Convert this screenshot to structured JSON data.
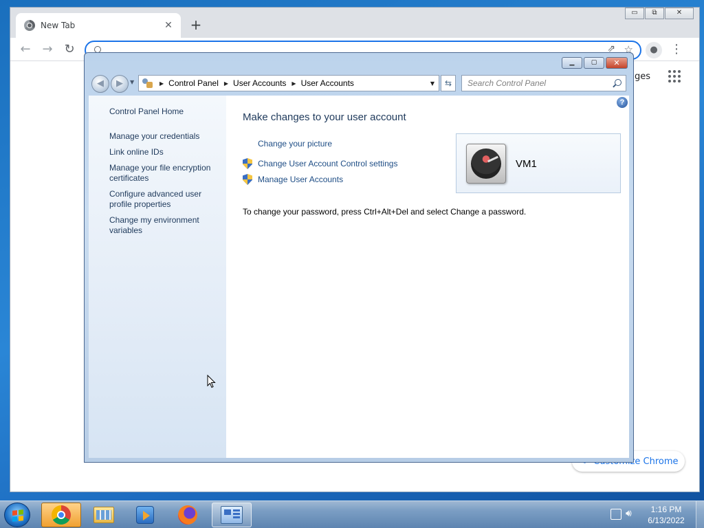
{
  "chrome": {
    "tab_title": "New Tab",
    "tab_close": "✕",
    "new_tab": "+",
    "window_controls": {
      "minimize": "▭",
      "maximize": "⧉",
      "close": "✕"
    },
    "nav": {
      "back": "←",
      "forward": "→",
      "reload": "↻"
    },
    "omnibox_value": "",
    "images_link": "ges",
    "customize_label": "Customize Chrome"
  },
  "control_panel": {
    "window_controls": {
      "minimize": "▁",
      "maximize": "▢",
      "close": "✕"
    },
    "breadcrumbs": [
      "Control Panel",
      "User Accounts",
      "User Accounts"
    ],
    "search_placeholder": "Search Control Panel",
    "left_links": [
      "Control Panel Home",
      "Manage your credentials",
      "Link online IDs",
      "Manage your file encryption certificates",
      "Configure advanced user profile properties",
      "Change my environment variables"
    ],
    "main_title": "Make changes to your user account",
    "tasks": [
      {
        "label": "Change your picture",
        "icon": "none"
      },
      {
        "label": "Change User Account Control settings",
        "icon": "uac-shield-icon"
      },
      {
        "label": "Manage User Accounts",
        "icon": "uac-shield-icon"
      }
    ],
    "info_text": "To change your password, press Ctrl+Alt+Del and select Change a password.",
    "user_name": "VM1",
    "help": "?"
  },
  "taskbar": {
    "time": "1:16 PM",
    "date": "6/13/2022",
    "items": [
      "chrome-icon",
      "file-explorer-icon",
      "media-player-icon",
      "firefox-icon",
      "control-panel-icon"
    ]
  }
}
